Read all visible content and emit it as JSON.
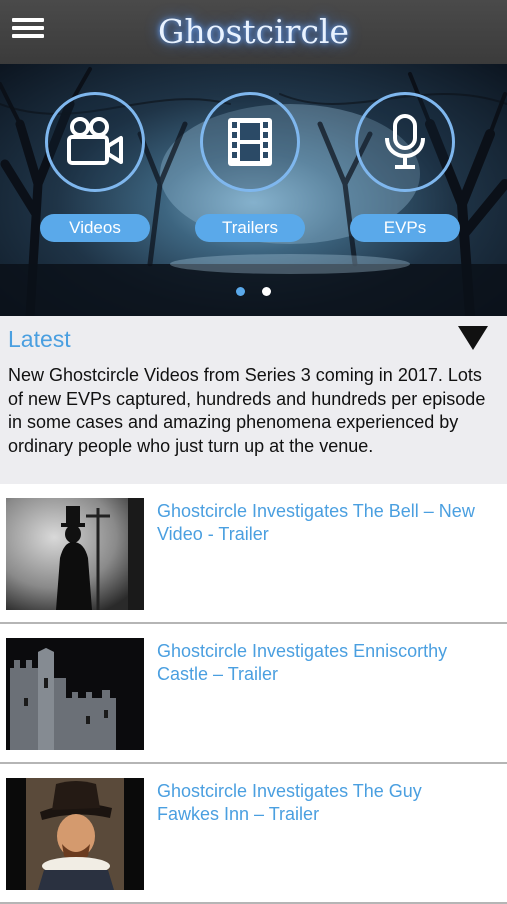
{
  "header": {
    "title": "Ghostcircle",
    "menu_icon": "hamburger-menu-icon"
  },
  "hero": {
    "categories": [
      {
        "label": "Videos",
        "icon": "video-camera-icon"
      },
      {
        "label": "Trailers",
        "icon": "film-strip-icon"
      },
      {
        "label": "EVPs",
        "icon": "microphone-icon"
      }
    ],
    "page_indicator": {
      "pages": 2,
      "current": 1
    }
  },
  "latest": {
    "title": "Latest",
    "toggle_icon": "triangle-down-icon",
    "text": "New Ghostcircle Videos from Series 3 coming in 2017. Lots of new EVPs captured, hundreds and hundreds per episode in some cases and amazing phenomena experienced by ordinary people who just turn up at the venue."
  },
  "videos": [
    {
      "title": "Ghostcircle Investigates The Bell – New Video - Trailer",
      "thumbnail": "dark-silhouette-top-hat-thumbnail"
    },
    {
      "title": "Ghostcircle Investigates Enniscorthy Castle – Trailer",
      "thumbnail": "castle-at-night-thumbnail"
    },
    {
      "title": "Ghostcircle Investigates The Guy Fawkes Inn – Trailer",
      "thumbnail": "guy-fawkes-portrait-thumbnail"
    }
  ],
  "colors": {
    "accent": "#4a9fe0",
    "pill": "#5aa9ea",
    "topbar": "#3b3b3b",
    "dot_active": "#5aa9ea",
    "dot_inactive": "#ffffff"
  }
}
